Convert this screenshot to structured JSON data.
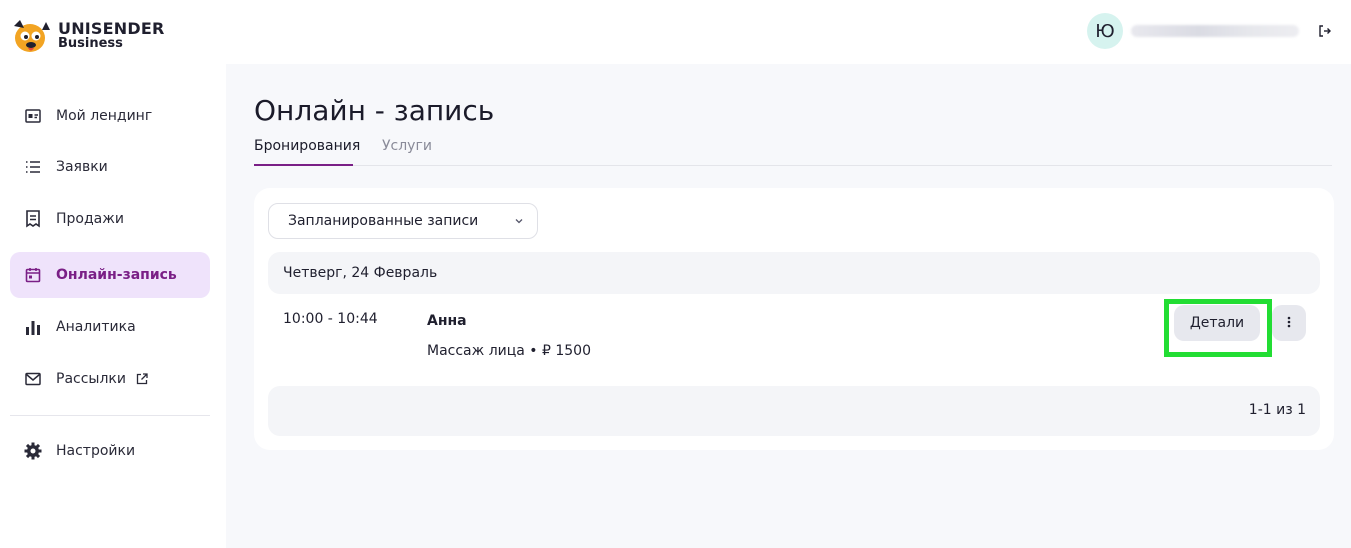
{
  "brand": {
    "name": "UNISENDER",
    "sub": "Business"
  },
  "user": {
    "initial": "Ю"
  },
  "sidebar": {
    "items": [
      {
        "label": "Мой лендинг",
        "icon": "landing-card-icon"
      },
      {
        "label": "Заявки",
        "icon": "list-icon"
      },
      {
        "label": "Продажи",
        "icon": "receipt-icon"
      },
      {
        "label": "Онлайн-запись",
        "icon": "calendar-icon",
        "active": true
      },
      {
        "label": "Аналитика",
        "icon": "bar-chart-icon"
      },
      {
        "label": "Рассылки",
        "icon": "mail-icon"
      },
      {
        "label": "Настройки",
        "icon": "gear-icon"
      }
    ]
  },
  "page": {
    "title": "Онлайн - запись",
    "tabs": [
      {
        "label": "Бронирования",
        "active": true
      },
      {
        "label": "Услуги",
        "active": false
      }
    ]
  },
  "filter": {
    "selected": "Запланированные записи"
  },
  "schedule": {
    "day": "Четверг, 24 Февраль",
    "bookings": [
      {
        "time": "10:00 - 10:44",
        "client": "Анна",
        "service": "Массаж лица • ₽ 1500",
        "details_label": "Детали"
      }
    ]
  },
  "pagination": {
    "text": "1-1 из 1"
  },
  "colors": {
    "accent": "#7a1f86",
    "active_bg": "#efe3fb",
    "highlight": "#22dd33",
    "avatar_bg": "#d6f3ef"
  }
}
